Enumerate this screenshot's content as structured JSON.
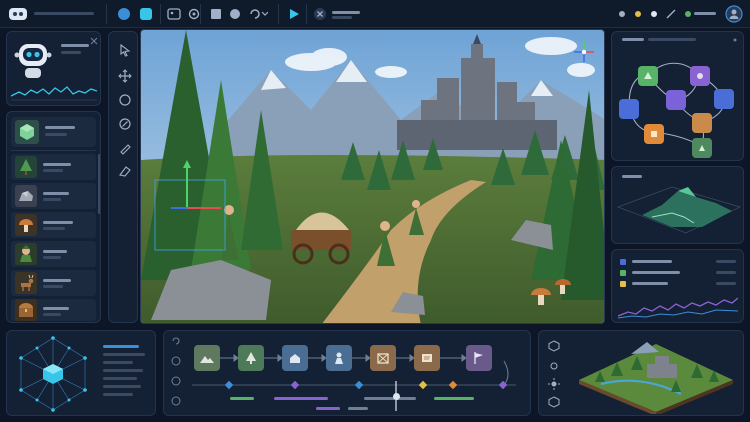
{
  "colors": {
    "app_bg": "#0d1626",
    "panel_bg": "#142033",
    "panel_border": "#24344d",
    "accent_blue": "#3a8fd8",
    "accent_cyan": "#38c6e8",
    "accent_green": "#58b368",
    "accent_purple": "#8a63d2",
    "accent_orange": "#e08a3a",
    "accent_yellow": "#e0c046",
    "placeholder": "#3a4a62"
  },
  "toolbar": {
    "icons": [
      "logo-icon",
      "scene-icon",
      "layer-icon",
      "image-icon",
      "settings-icon",
      "stop-icon",
      "record-icon",
      "loop-icon",
      "play-icon",
      "close-icon",
      "notification-icon",
      "palette-icon",
      "edit-icon",
      "user-icon"
    ]
  },
  "tools": [
    "select-tool",
    "move-tool",
    "rotate-tool",
    "scale-tool",
    "paint-tool",
    "erase-tool"
  ],
  "assets": [
    "forest-tree",
    "rock",
    "mushroom",
    "elf-ranger",
    "deer",
    "treasure-chest"
  ],
  "timeline": {
    "nodes": [
      "terrain",
      "tree",
      "village",
      "character",
      "crate",
      "scroll",
      "flag"
    ],
    "node_colors": [
      "#5e7a5e",
      "#4e7a5a",
      "#4a6d94",
      "#4a6d94",
      "#8a6a4a",
      "#8a6a4a",
      "#6a5a8a"
    ]
  },
  "node_graph": {
    "nodes": [
      "blue",
      "green",
      "purple",
      "purple",
      "blue",
      "orange",
      "orange",
      "green"
    ]
  }
}
